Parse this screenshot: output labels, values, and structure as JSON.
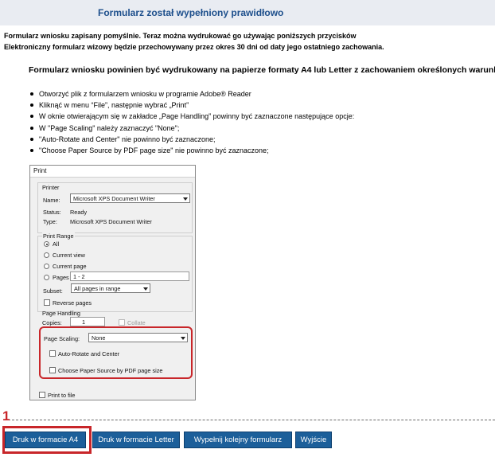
{
  "header": {
    "title": "Formularz został wypełniony prawidłowo"
  },
  "intro": {
    "line1": "Formularz wniosku zapisany pomyślnie. Teraz można wydrukować go używając poniższych przycisków",
    "line2": "Elektroniczny formularz wizowy będzie przechowywany przez okres 30 dni od daty jego ostatniego zachowania."
  },
  "instructions": {
    "heading": "Formularz wniosku powinien być wydrukowany na papierze formaty A4 lub Letter z zachowaniem określonych warunków:",
    "items": [
      "Otworzyć plik z formularzem wniosku w programie Adobe® Reader",
      "Kliknąć w menu “File”, następnie wybrać „Print”",
      "W oknie otwierającym się w zakładce „Page Handling” powinny być zaznaczone następujące opcje:",
      "W \"Page Scaling\" należy zaznaczyć \"None\";",
      "\"Auto-Rotate and Center\" nie powinno być zaznaczone;",
      "\"Choose Paper Source by PDF page size\" nie powinno być zaznaczone;"
    ]
  },
  "print_dialog": {
    "title": "Print",
    "printer_group": "Printer",
    "name_label": "Name:",
    "name_value": "Microsoft XPS Document Writer",
    "status_label": "Status:",
    "status_value": "Ready",
    "type_label": "Type:",
    "type_value": "Microsoft XPS Document Writer",
    "range_group": "Print Range",
    "range_all": "All",
    "range_current_view": "Current view",
    "range_current_page": "Current page",
    "range_pages": "Pages",
    "pages_value": "1 - 2",
    "subset_label": "Subset:",
    "subset_value": "All pages in range",
    "reverse_pages": "Reverse pages",
    "handling_group": "Page Handling",
    "copies_label": "Copies:",
    "copies_value": "1",
    "collate": "Collate",
    "scaling_label": "Page Scaling:",
    "scaling_value": "None",
    "auto_rotate": "Auto-Rotate and Center",
    "paper_source": "Choose Paper Source by PDF page size",
    "print_to_file": "Print to file"
  },
  "marker": "1",
  "buttons": {
    "a4": "Druk w formacie A4",
    "letter": "Druk w formacie Letter",
    "next_form": "Wypełnij kolejny formularz",
    "exit": "Wyjście"
  },
  "colors": {
    "header_bg": "#e9ecf2",
    "title": "#1d4f8c",
    "button": "#1c5f9a",
    "highlight": "#c8262a"
  }
}
